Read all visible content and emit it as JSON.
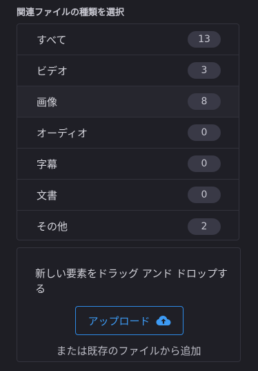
{
  "heading": "関連ファイルの種類を選択",
  "filters": [
    {
      "label": "すべて",
      "count": "13"
    },
    {
      "label": "ビデオ",
      "count": "3"
    },
    {
      "label": "画像",
      "count": "8"
    },
    {
      "label": "オーディオ",
      "count": "0"
    },
    {
      "label": "字幕",
      "count": "0"
    },
    {
      "label": "文書",
      "count": "0"
    },
    {
      "label": "その他",
      "count": "2"
    }
  ],
  "selected_filter": "画像",
  "upload": {
    "drop_text": "新しい要素をドラッグ アンド ドロップする",
    "button_label": "アップロード",
    "button_icon": "cloud-upload-icon",
    "secondary_text": "または既存のファイルから追加"
  },
  "colors": {
    "accent": "#2e8be8",
    "background": "#1e1e24",
    "badge": "#393946"
  }
}
